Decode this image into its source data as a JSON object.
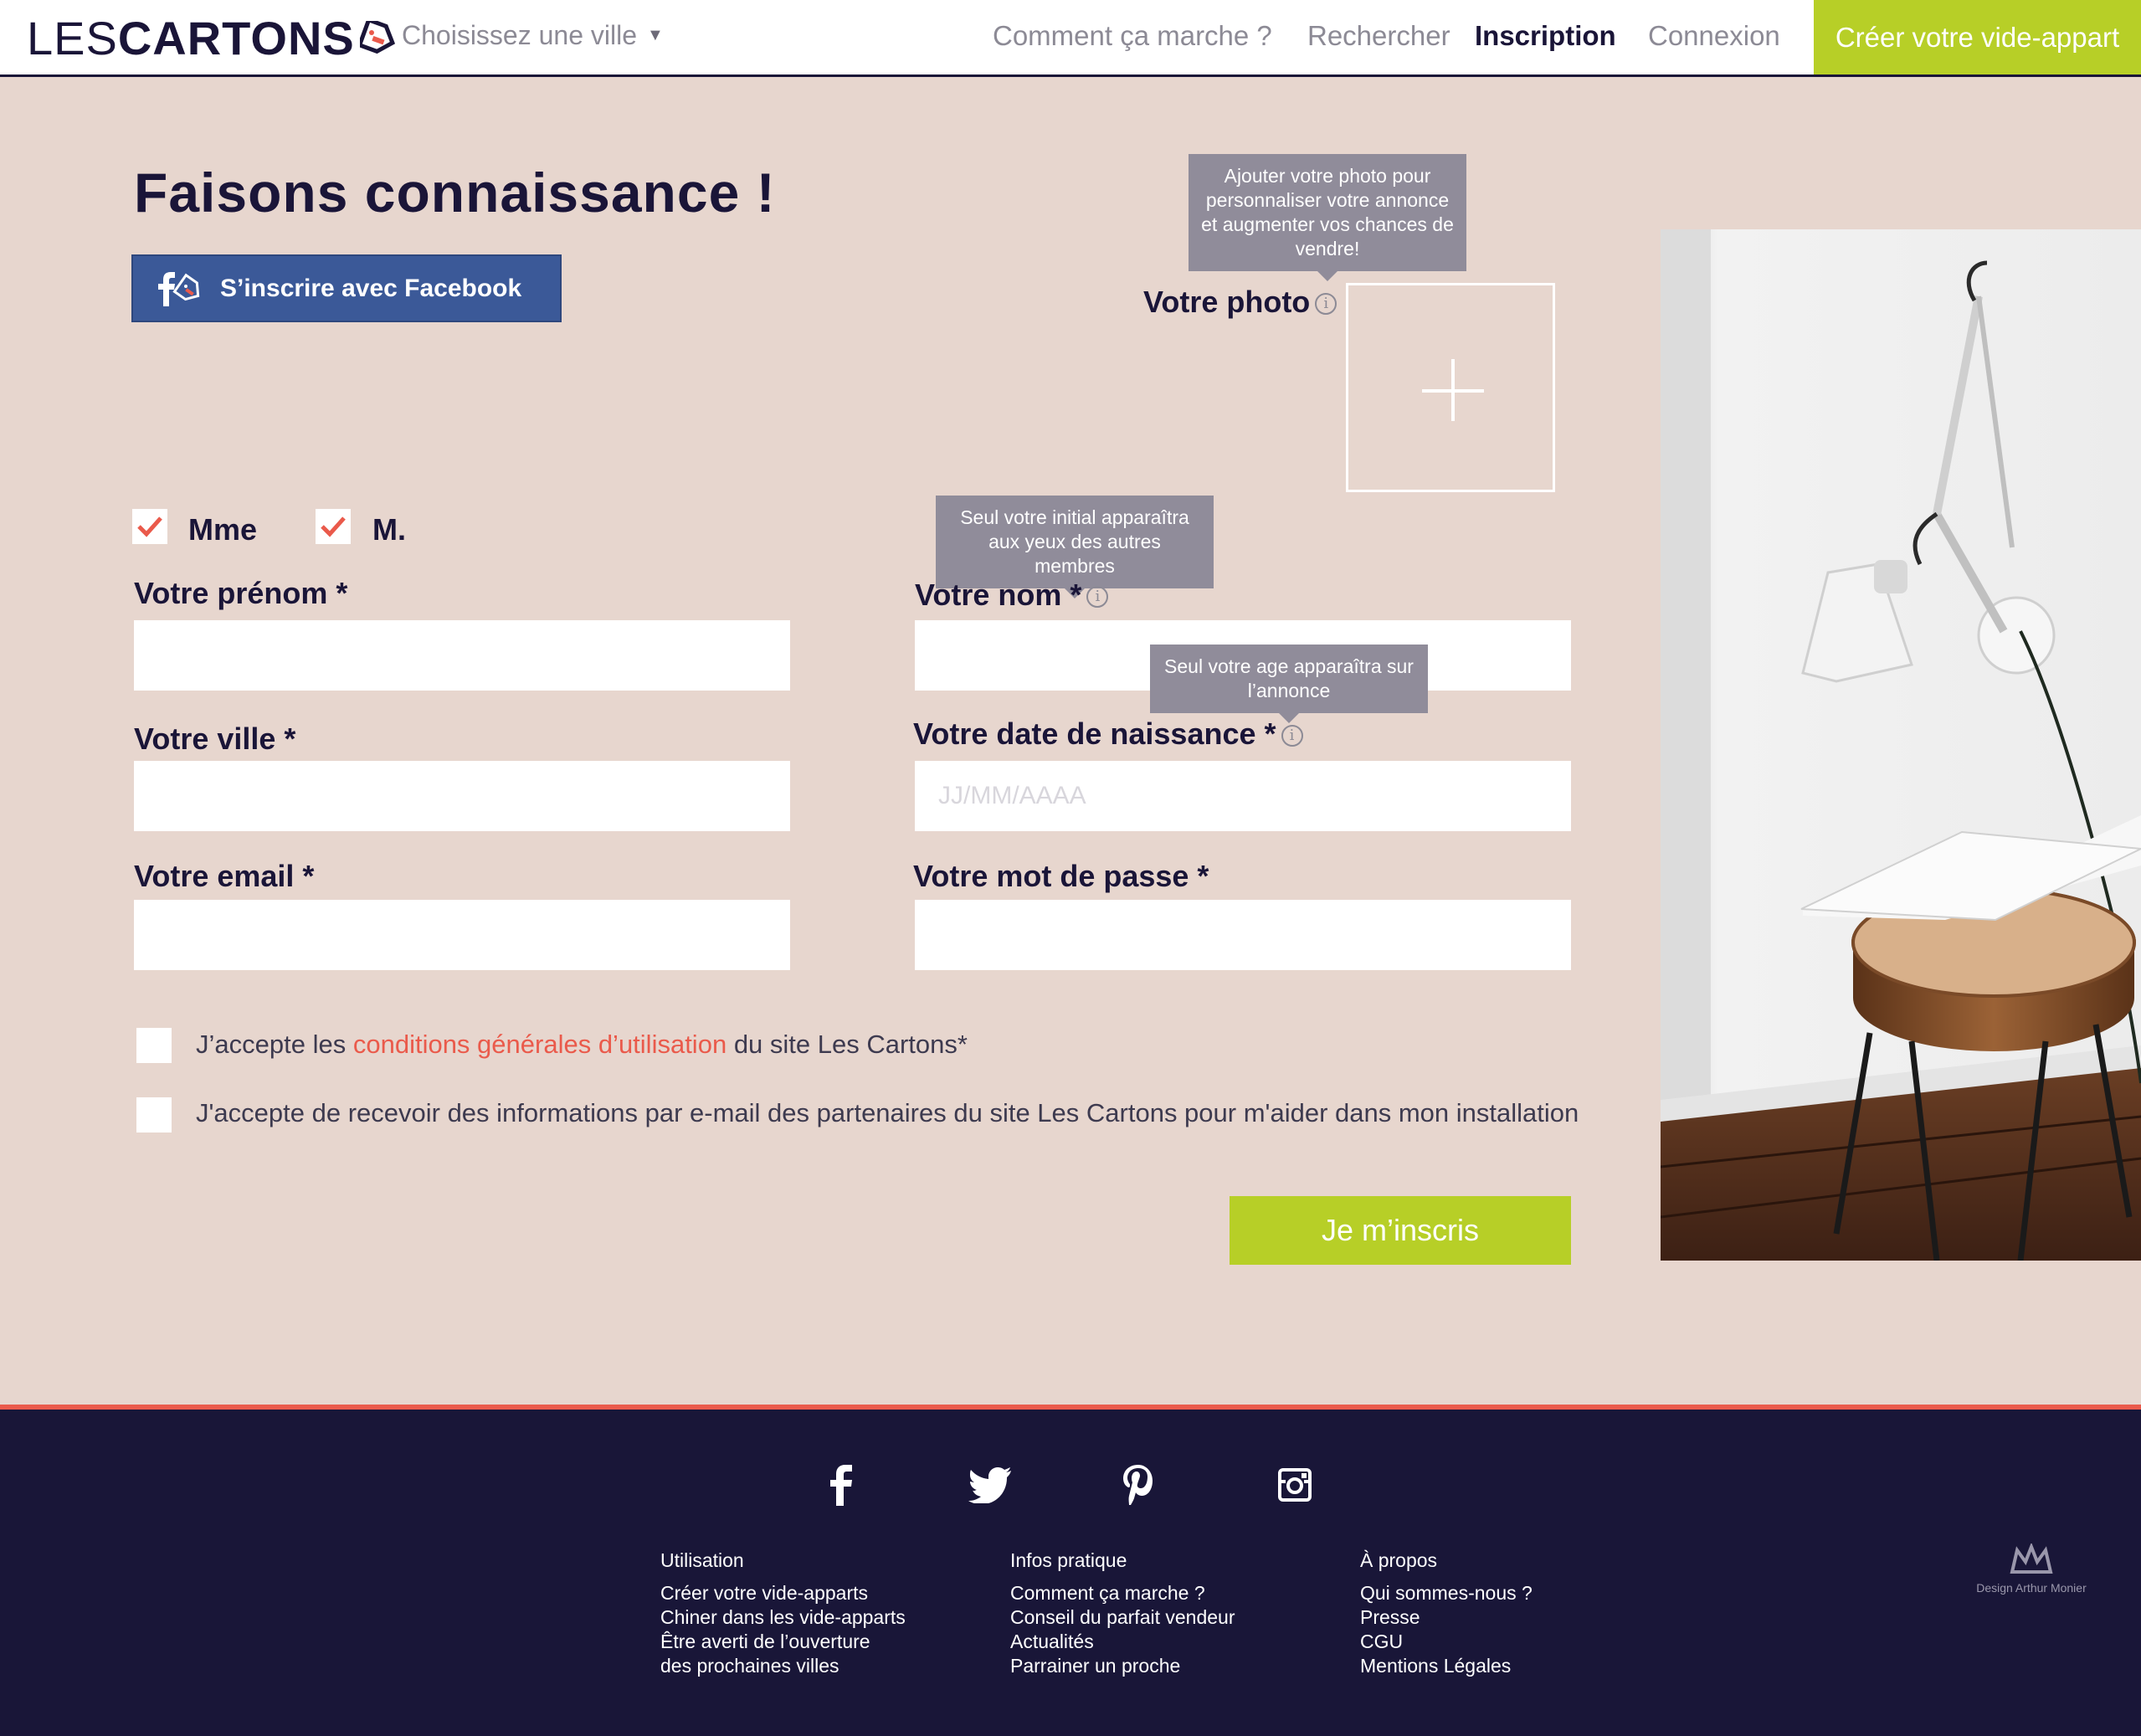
{
  "header": {
    "logo_light": "LES",
    "logo_bold": "CARTONS",
    "city_select": "Choisissez une ville",
    "nav": {
      "how": "Comment ça marche ?",
      "search": "Rechercher",
      "signup": "Inscription",
      "login": "Connexion"
    },
    "create_button": "Créer votre vide-appart"
  },
  "form": {
    "title": "Faisons connaissance !",
    "facebook_button": "S’inscrire avec Facebook",
    "photo_tooltip": "Ajouter votre photo pour personnaliser votre annonce et augmenter vos chances de vendre!",
    "photo_label": "Votre photo",
    "gender": {
      "mme": "Mme",
      "m": "M."
    },
    "name_tooltip": "Seul votre initial apparaîtra aux yeux des autres membres",
    "firstname_label": "Votre prénom *",
    "lastname_label": "Votre nom *",
    "age_tooltip": "Seul votre age apparaîtra sur l’annonce",
    "city_label": "Votre ville *",
    "birthdate_label": "Votre date de naissance *",
    "birthdate_placeholder": "JJ/MM/AAAA",
    "email_label": "Votre email *",
    "password_label": "Votre mot de passe *",
    "cgu_prefix": "J’accepte les",
    "cgu_link": "conditions générales d’utilisation",
    "cgu_suffix": "du site Les Cartons*",
    "partners_consent": "J'accepte de recevoir des informations par e-mail des partenaires du site Les Cartons pour m'aider dans mon installation",
    "submit": "Je m’inscris"
  },
  "colors": {
    "accent_green": "#b7cf27",
    "navy": "#1a1538",
    "coral": "#ea5a4b",
    "background": "#e7d6ce",
    "facebook": "#3b5998"
  },
  "footer": {
    "social_icons": [
      "facebook-icon",
      "twitter-icon",
      "pinterest-icon",
      "instagram-icon"
    ],
    "columns": [
      {
        "title": "Utilisation",
        "items": [
          "Créer votre vide-apparts",
          "Chiner dans les vide-apparts",
          "Être averti de l’ouverture",
          "des prochaines villes"
        ]
      },
      {
        "title": "Infos pratique",
        "items": [
          "Comment ça marche ?",
          "Conseil du parfait vendeur",
          "Actualités",
          "Parrainer un proche"
        ]
      },
      {
        "title": "À propos",
        "items": [
          "Qui sommes-nous ?",
          "Presse",
          "CGU",
          "Mentions Légales"
        ]
      }
    ],
    "credit": "Design Arthur Monier"
  }
}
